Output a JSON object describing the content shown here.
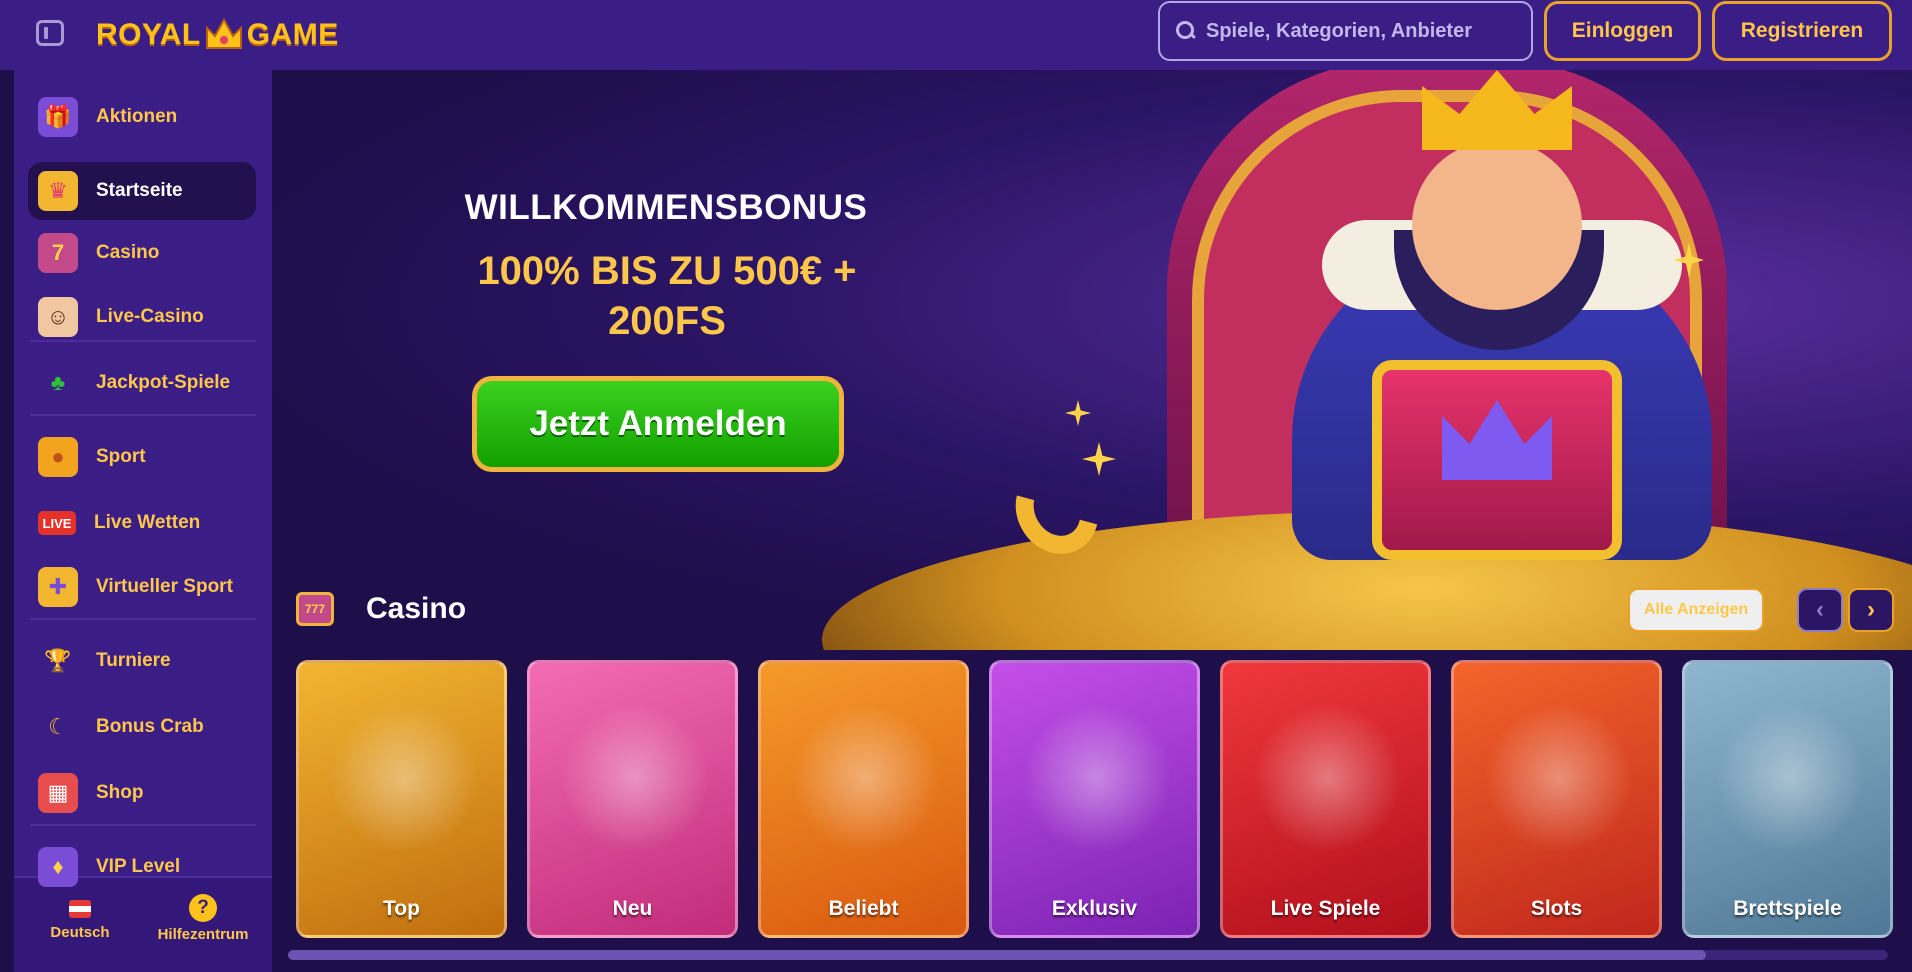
{
  "header": {
    "logo_left": "ROYAL",
    "logo_right": "GAME",
    "search_placeholder": "Spiele, Kategorien, Anbieter",
    "login_label": "Einloggen",
    "register_label": "Registrieren"
  },
  "sidebar": {
    "items": [
      {
        "label": "Aktionen",
        "icon": "gift-chest-icon"
      },
      {
        "label": "Startseite",
        "icon": "crown-icon"
      },
      {
        "label": "Casino",
        "icon": "slot-machine-icon"
      },
      {
        "label": "Live-Casino",
        "icon": "dealer-icon"
      },
      {
        "label": "Jackpot-Spiele",
        "icon": "clover-icon"
      },
      {
        "label": "Sport",
        "icon": "ball-icon"
      },
      {
        "label": "Live Wetten",
        "icon": "live-badge-icon",
        "badge": "LIVE"
      },
      {
        "label": "Virtueller Sport",
        "icon": "gamepad-icon"
      },
      {
        "label": "Turniere",
        "icon": "trophy-icon"
      },
      {
        "label": "Bonus Crab",
        "icon": "crab-claw-icon"
      },
      {
        "label": "Shop",
        "icon": "shop-icon"
      },
      {
        "label": "VIP Level",
        "icon": "vip-icon"
      }
    ],
    "active_index": 1,
    "footer": {
      "language_label": "Deutsch",
      "help_label": "Hilfezentrum",
      "help_glyph": "?"
    }
  },
  "hero": {
    "title": "WILLKOMMENSBONUS",
    "offer_line1": "100% BIS ZU 500€ +",
    "offer_line2": "200FS",
    "cta_label": "Jetzt Anmelden"
  },
  "casino": {
    "title": "Casino",
    "icon_glyph": "777",
    "view_all_label": "Alle Anzeigen",
    "prev_glyph": "‹",
    "next_glyph": "›",
    "cards": [
      {
        "label": "Top",
        "color_from": "#f2b531",
        "color_to": "#c06d0e"
      },
      {
        "label": "Neu",
        "color_from": "#f36cb3",
        "color_to": "#c12c7a"
      },
      {
        "label": "Beliebt",
        "color_from": "#f59a2a",
        "color_to": "#d9570f"
      },
      {
        "label": "Exklusiv",
        "color_from": "#c54fe8",
        "color_to": "#7b22b3"
      },
      {
        "label": "Live Spiele",
        "color_from": "#f0383c",
        "color_to": "#b10f1c"
      },
      {
        "label": "Slots",
        "color_from": "#f4642a",
        "color_to": "#c0261c"
      },
      {
        "label": "Brettspiele",
        "color_from": "#8fb6cf",
        "color_to": "#4f7896"
      }
    ]
  },
  "colors": {
    "accent": "#ffc74a",
    "header_bg": "#3a1d85",
    "page_bg": "#1e0e4a",
    "cta_green": "#12a000"
  }
}
